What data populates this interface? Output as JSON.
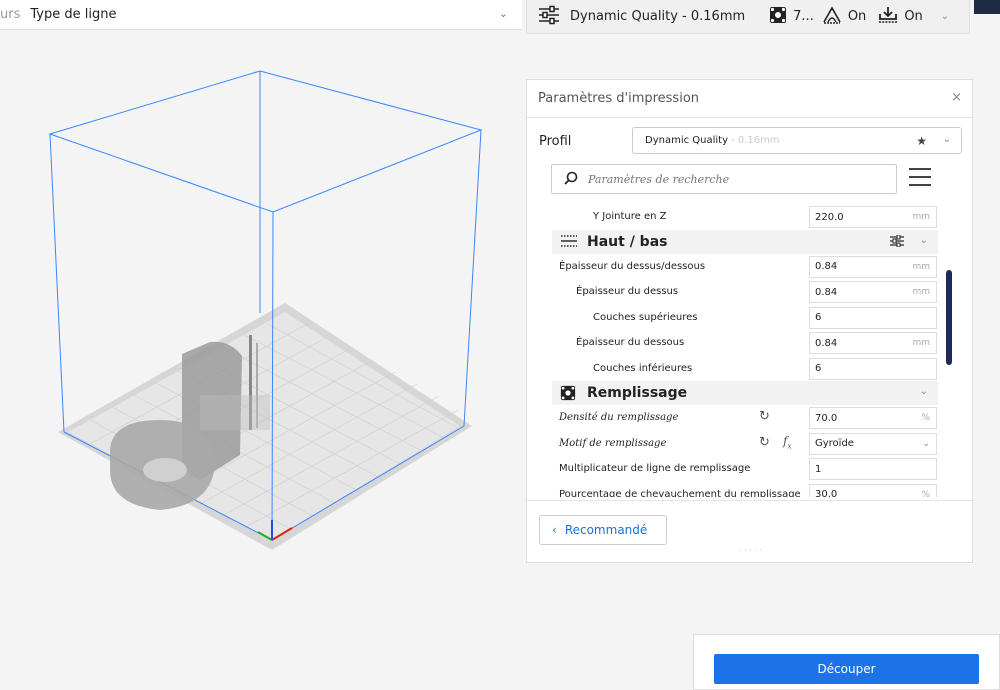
{
  "toolbar_left": {
    "prefix": "urs",
    "view_type": "Type de ligne"
  },
  "toolbar_right": {
    "quality": "Dynamic Quality - 0.16mm",
    "infill": "7...",
    "support": "On",
    "adhesion": "On"
  },
  "panel": {
    "title": "Paramètres d'impression",
    "profile_label": "Profil",
    "profile_name": "Dynamic Quality",
    "profile_sub": "- 0.16mm",
    "search_placeholder": "Paramètres de recherche",
    "rows": [
      {
        "type": "setting",
        "indent": 2,
        "label": "Y Jointure en Z",
        "value": "220.0",
        "unit": "mm"
      },
      {
        "type": "category",
        "label": "Haut / bas",
        "icon": "top-bottom-icon"
      },
      {
        "type": "setting",
        "indent": 0,
        "label": "Épaisseur du dessus/dessous",
        "value": "0.84",
        "unit": "mm"
      },
      {
        "type": "setting",
        "indent": 1,
        "label": "Épaisseur du dessus",
        "value": "0.84",
        "unit": "mm"
      },
      {
        "type": "setting",
        "indent": 2,
        "label": "Couches supérieures",
        "value": "6",
        "unit": ""
      },
      {
        "type": "setting",
        "indent": 1,
        "label": "Épaisseur du dessous",
        "value": "0.84",
        "unit": "mm"
      },
      {
        "type": "setting",
        "indent": 2,
        "label": "Couches inférieures",
        "value": "6",
        "unit": ""
      },
      {
        "type": "category",
        "label": "Remplissage",
        "icon": "infill-icon"
      },
      {
        "type": "setting",
        "indent": 0,
        "italic": true,
        "reset": true,
        "label": "Densité du remplissage",
        "value": "70.0",
        "unit": "%"
      },
      {
        "type": "setting",
        "indent": 0,
        "italic": true,
        "reset": true,
        "fx": true,
        "select": true,
        "label": "Motif de remplissage",
        "value": "Gyroïde",
        "unit": ""
      },
      {
        "type": "setting",
        "indent": 0,
        "label": "Multiplicateur de ligne de remplissage",
        "value": "1",
        "unit": ""
      },
      {
        "type": "setting",
        "indent": 0,
        "label": "Pourcentage de chevauchement du remplissage",
        "value": "30.0",
        "unit": "%"
      }
    ],
    "recommended_label": "Recommandé"
  },
  "slice": {
    "label": "Découper"
  },
  "colors": {
    "accent": "#1e72e8",
    "scroll": "#1f2a5a",
    "box": "#3a86ff"
  }
}
